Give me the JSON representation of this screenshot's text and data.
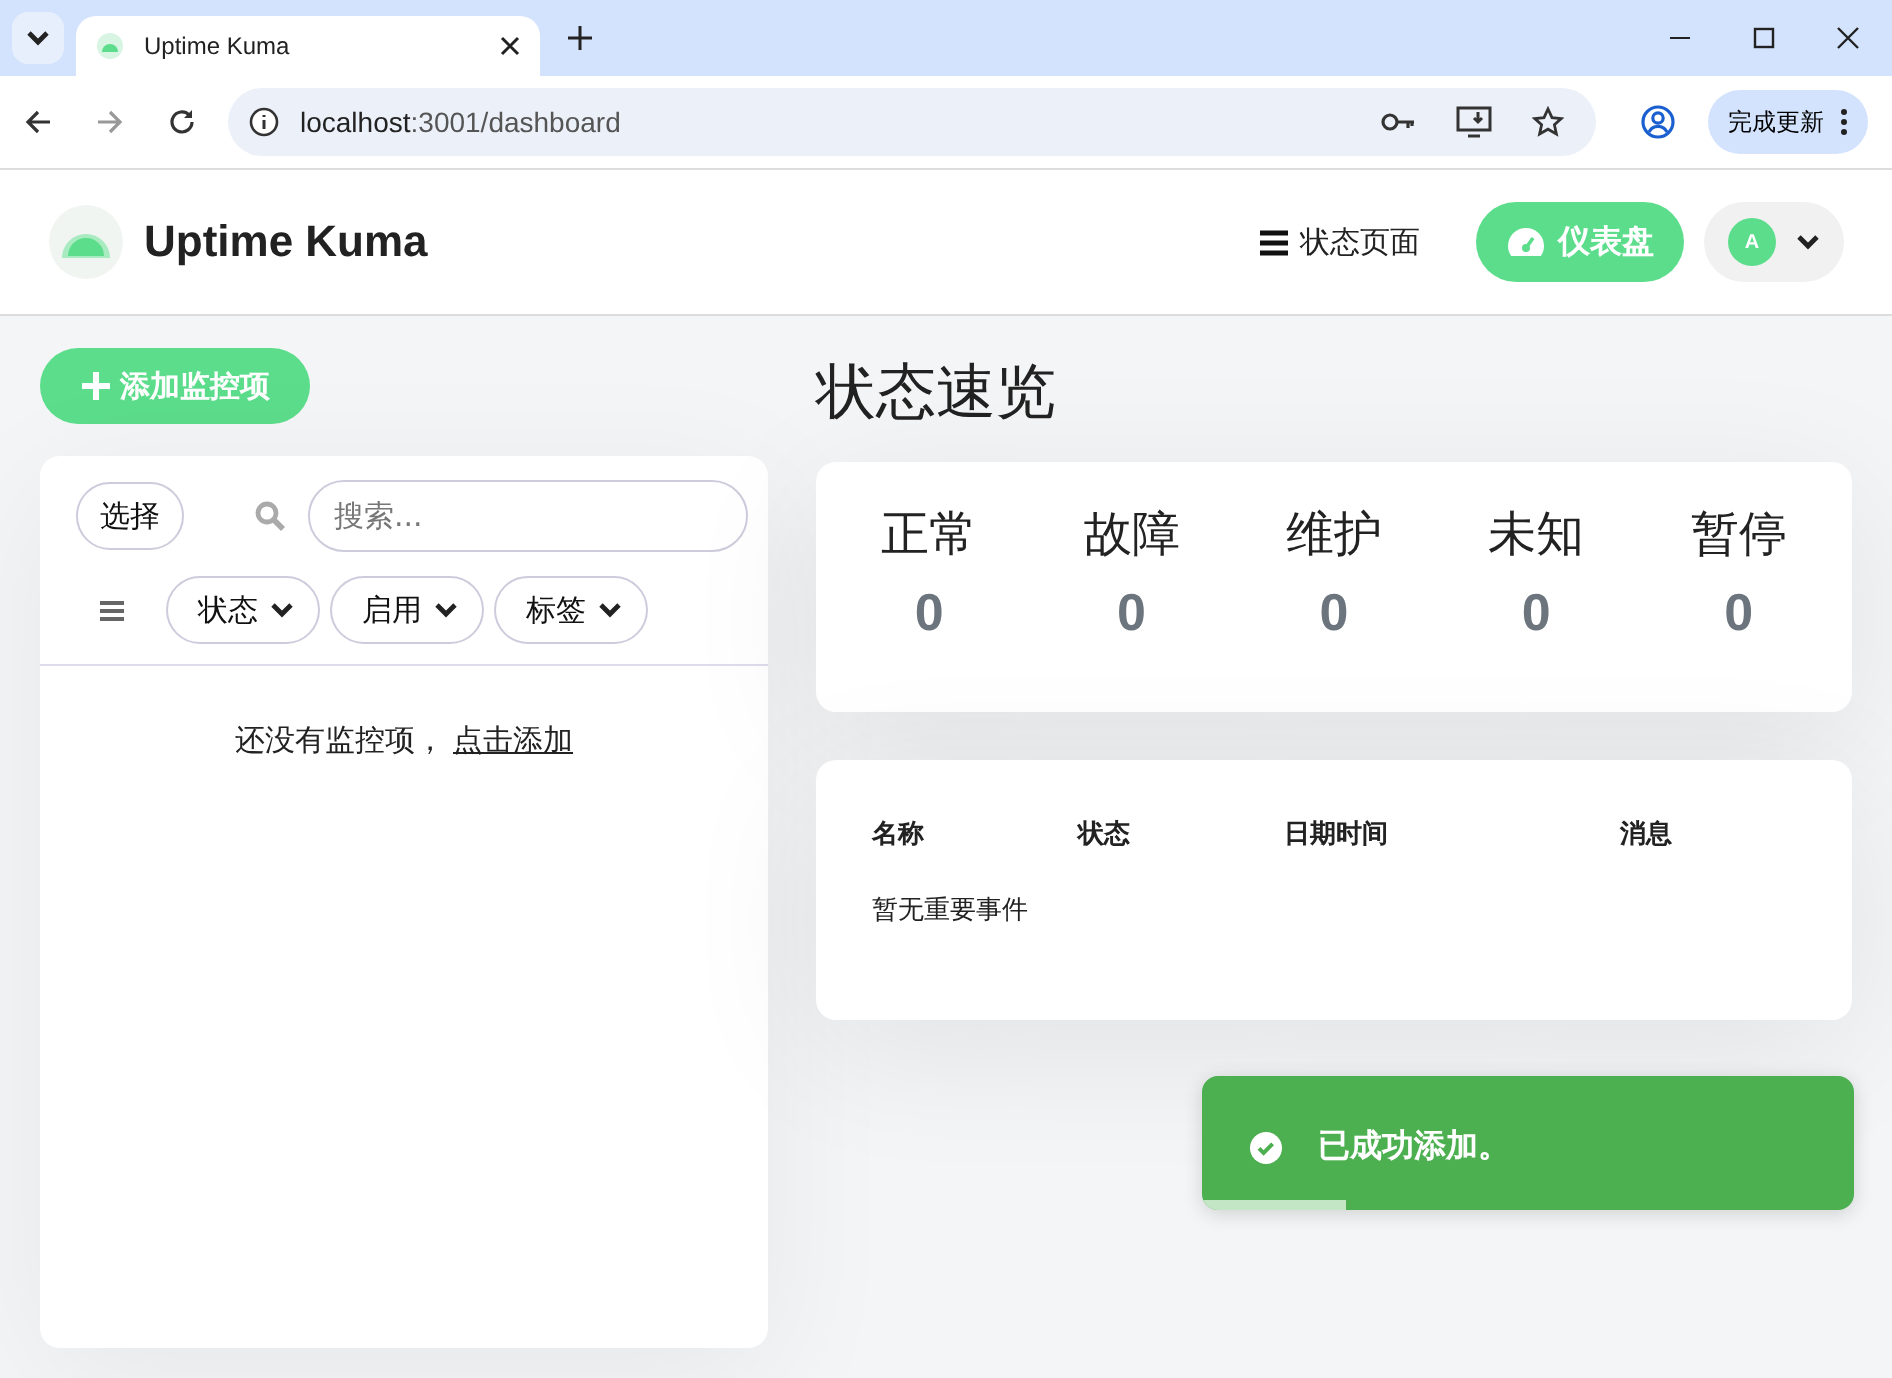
{
  "browser": {
    "tab_title": "Uptime Kuma",
    "url_host": "localhost",
    "url_rest": ":3001/dashboard",
    "update_button": "完成更新"
  },
  "header": {
    "brand": "Uptime Kuma",
    "status_pages": "状态页面",
    "dashboard": "仪表盘",
    "avatar": "A"
  },
  "sidebar": {
    "add_button": "添加监控项",
    "select_button": "选择",
    "search": {
      "placeholder": "搜索..."
    },
    "filters": [
      "状态",
      "启用",
      "标签"
    ],
    "empty_text": "还没有监控项，",
    "empty_link": "点击添加"
  },
  "overview": {
    "title": "状态速览",
    "stats": [
      {
        "label": "正常",
        "value": "0"
      },
      {
        "label": "故障",
        "value": "0"
      },
      {
        "label": "维护",
        "value": "0"
      },
      {
        "label": "未知",
        "value": "0"
      },
      {
        "label": "暂停",
        "value": "0"
      }
    ]
  },
  "events": {
    "columns": [
      "名称",
      "状态",
      "日期时间",
      "消息"
    ],
    "empty": "暂无重要事件"
  },
  "toast": {
    "message": "已成功添加。",
    "level": 0.22
  }
}
